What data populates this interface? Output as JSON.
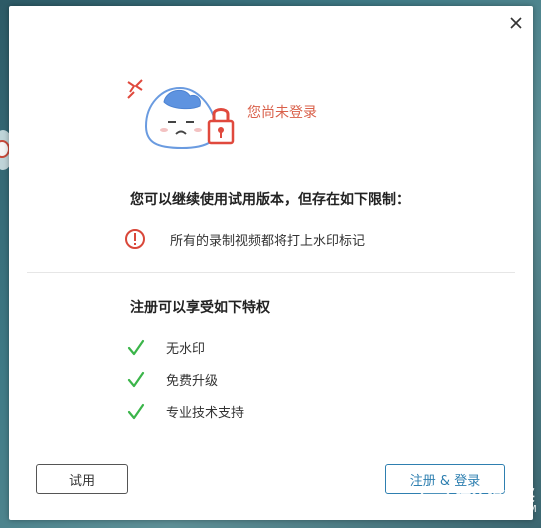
{
  "dialog": {
    "login_status": "您尚未登录",
    "trial_heading": "您可以继续使用试用版本，但存在如下限制：",
    "restriction": "所有的录制视频都将打上水印标记",
    "benefits_heading": "注册可以享受如下特权",
    "benefits": [
      "无水印",
      "免费升级",
      "专业技术支持"
    ],
    "trial_button": "试用",
    "register_button": "注册 & 登录"
  },
  "icons": {
    "close": "close-icon",
    "hero": "sad-mascot-lock-illustration",
    "warning": "warning-circle-icon",
    "check": "check-icon"
  },
  "colors": {
    "accent_blue": "#2e7fb0",
    "warning_red": "#d9473a",
    "status_text": "#d9604a",
    "check_green": "#3bb54a"
  },
  "watermark": {
    "cn": "什么值得买",
    "en": "SMZDM.COM"
  }
}
